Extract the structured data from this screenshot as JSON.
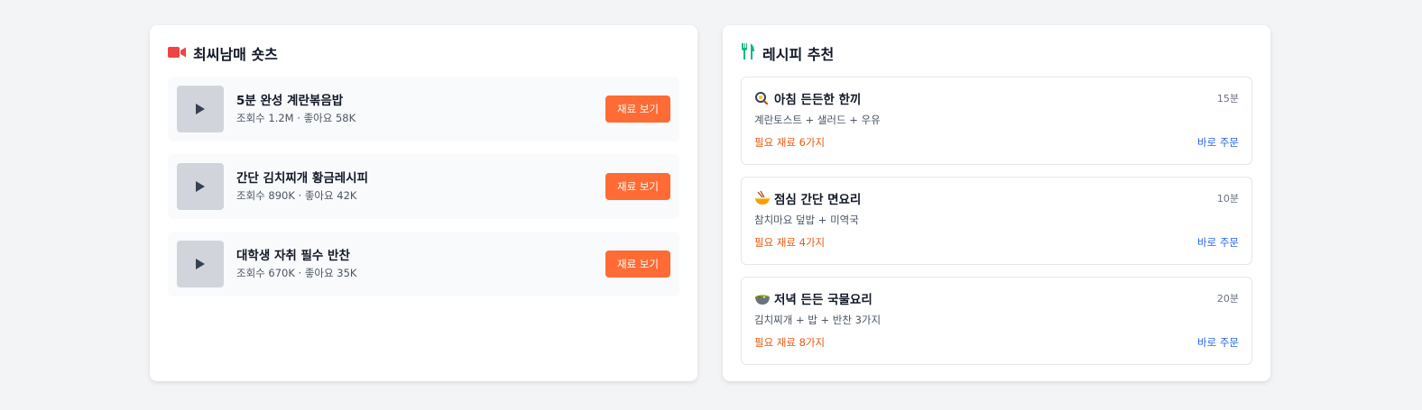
{
  "shorts": {
    "title": "최씨남매 숏츠",
    "accent": "#ef4444",
    "items": [
      {
        "title": "5분 완성 계란볶음밥",
        "meta": "조회수 1.2M · 좋아요 58K",
        "button": "재료 보기"
      },
      {
        "title": "간단 김치찌개 황금레시피",
        "meta": "조회수 890K · 좋아요 42K",
        "button": "재료 보기"
      },
      {
        "title": "대학생 자취 필수 반찬",
        "meta": "조회수 670K · 좋아요 35K",
        "button": "재료 보기"
      }
    ]
  },
  "recipes": {
    "title": "레시피 추천",
    "accent": "#10b981",
    "items": [
      {
        "icon": "frying-pan-icon",
        "title": "아침 든든한 한끼",
        "time": "15분",
        "desc": "계란토스트 + 샐러드 + 우유",
        "need": "필요 재료 6가지",
        "order": "바로 주문"
      },
      {
        "icon": "noodle-bowl-icon",
        "title": "점심 간단 면요리",
        "time": "10분",
        "desc": "참치마요 덮밥 + 미역국",
        "need": "필요 재료 4가지",
        "order": "바로 주문"
      },
      {
        "icon": "stew-bowl-icon",
        "title": "저녁 든든 국물요리",
        "time": "20분",
        "desc": "김치찌개 + 밥 + 반찬 3가지",
        "need": "필요 재료 8가지",
        "order": "바로 주문"
      }
    ]
  }
}
